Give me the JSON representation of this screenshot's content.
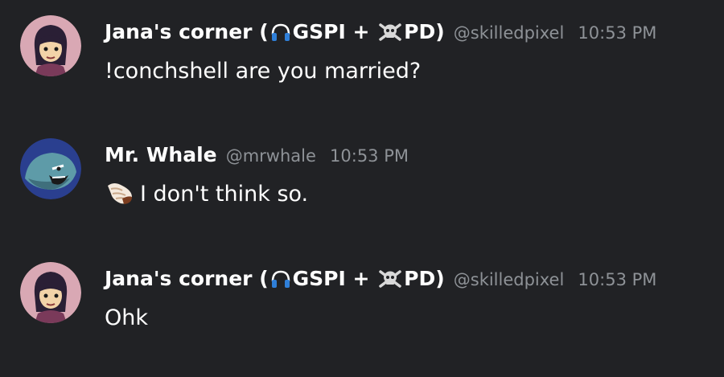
{
  "messages": [
    {
      "author": {
        "name_prefix": "Jana's corner (",
        "role_a": "GSPI + ",
        "role_b": "PD)",
        "handle": "@skilledpixel",
        "avatar_icon": "girl-avatar-icon"
      },
      "timestamp": "10:53 PM",
      "text": "!conchshell are you married?"
    },
    {
      "author": {
        "name": "Mr. Whale",
        "handle": "@mrwhale",
        "avatar_icon": "whale-avatar-icon"
      },
      "timestamp": "10:53 PM",
      "emoji_icon": "conch-shell-icon",
      "text": "I don't think so."
    },
    {
      "author": {
        "name_prefix": "Jana's corner (",
        "role_a": "GSPI + ",
        "role_b": "PD)",
        "handle": "@skilledpixel",
        "avatar_icon": "girl-avatar-icon"
      },
      "timestamp": "10:53 PM",
      "text": "Ohk"
    }
  ],
  "colors": {
    "background": "#212225",
    "text": "#ffffff",
    "muted": "#8e9297",
    "headphones": "#2f7fd8",
    "avatar_pink": "#d9a8b4",
    "avatar_blue": "#2a3f8f"
  }
}
